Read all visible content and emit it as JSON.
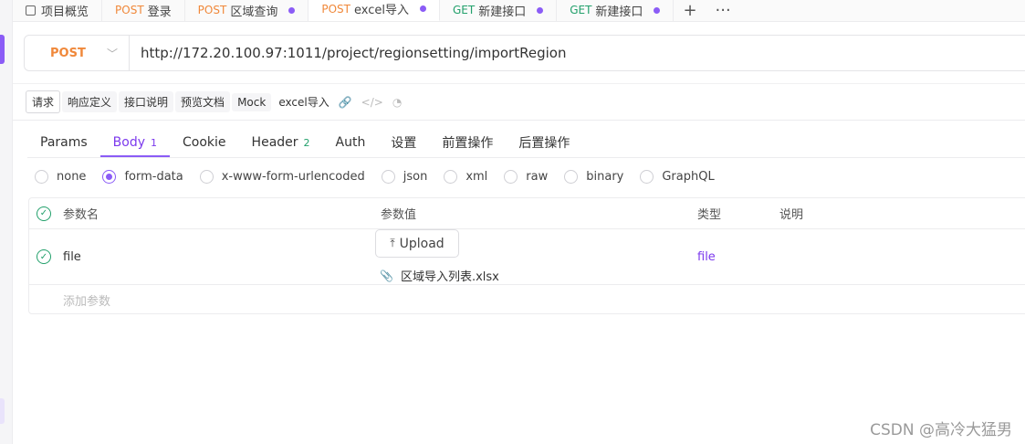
{
  "tabs": [
    {
      "method": "",
      "label": "项目概览",
      "dot": false,
      "active": false
    },
    {
      "method": "POST",
      "label": "登录",
      "dot": false,
      "active": false
    },
    {
      "method": "POST",
      "label": "区域查询",
      "dot": true,
      "active": false
    },
    {
      "method": "POST",
      "label": "excel导入",
      "dot": true,
      "active": true
    },
    {
      "method": "GET",
      "label": "新建接口",
      "dot": true,
      "active": false
    },
    {
      "method": "GET",
      "label": "新建接口",
      "dot": true,
      "active": false
    }
  ],
  "tab_add": "+",
  "tab_more": "···",
  "request": {
    "method": "POST",
    "url": "http://172.20.100.97:1011/project/regionsetting/importRegion"
  },
  "subtoolbar": {
    "items": [
      "请求",
      "响应定义",
      "接口说明",
      "预览文档",
      "Mock"
    ],
    "name": "excel导入"
  },
  "param_tabs": [
    {
      "label": "Params",
      "count": ""
    },
    {
      "label": "Body",
      "count": "1",
      "active": true
    },
    {
      "label": "Cookie",
      "count": ""
    },
    {
      "label": "Header",
      "count": "2"
    },
    {
      "label": "Auth",
      "count": ""
    },
    {
      "label": "设置",
      "count": ""
    },
    {
      "label": "前置操作",
      "count": ""
    },
    {
      "label": "后置操作",
      "count": ""
    }
  ],
  "body_types": [
    {
      "label": "none",
      "selected": false
    },
    {
      "label": "form-data",
      "selected": true
    },
    {
      "label": "x-www-form-urlencoded",
      "selected": false
    },
    {
      "label": "json",
      "selected": false
    },
    {
      "label": "xml",
      "selected": false
    },
    {
      "label": "raw",
      "selected": false
    },
    {
      "label": "binary",
      "selected": false
    },
    {
      "label": "GraphQL",
      "selected": false
    }
  ],
  "table": {
    "headers": {
      "name": "参数名",
      "value": "参数值",
      "type": "类型",
      "desc": "说明"
    },
    "rows": [
      {
        "name": "file",
        "upload_label": "Upload",
        "file_name": "区域导入列表.xlsx",
        "type": "file",
        "desc": ""
      }
    ],
    "add_placeholder": "添加参数"
  },
  "watermark": "CSDN @高冷大猛男",
  "colors": {
    "accent": "#8b5cf6",
    "post": "#f0883a",
    "get": "#22a06b"
  }
}
